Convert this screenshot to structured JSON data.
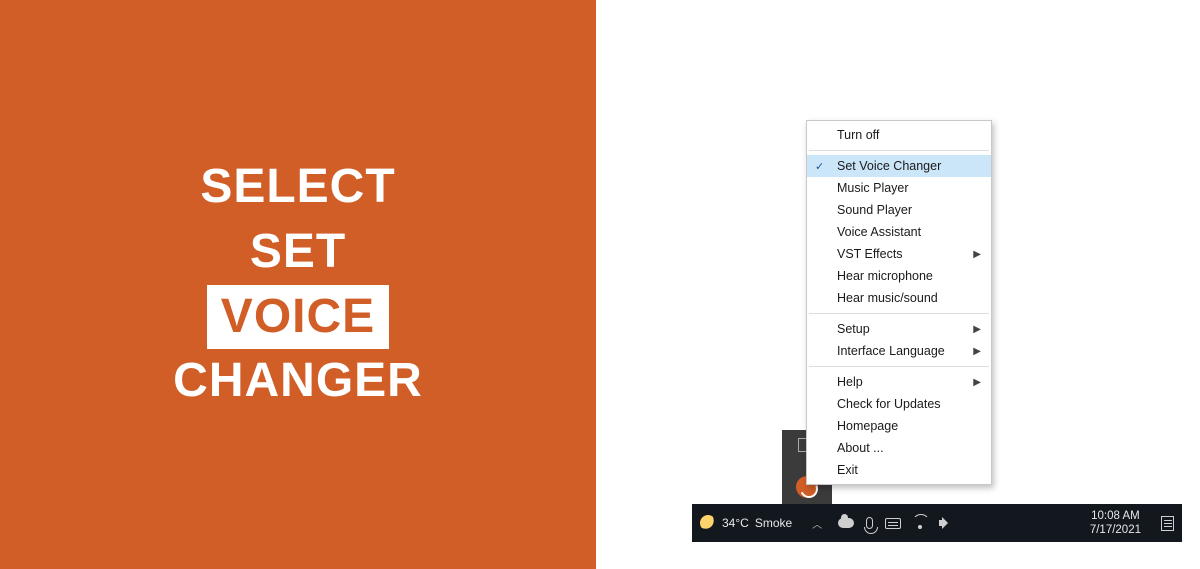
{
  "left_panel": {
    "line1": "SELECT",
    "line2": "SET",
    "line3_boxed": "VOICE",
    "line4": "CHANGER"
  },
  "context_menu": {
    "sections": [
      {
        "items": [
          {
            "label": "Turn off",
            "checked": false,
            "submenu": false
          }
        ]
      },
      {
        "items": [
          {
            "label": "Set Voice Changer",
            "checked": true,
            "submenu": false,
            "selected": true
          },
          {
            "label": "Music Player",
            "checked": false,
            "submenu": false
          },
          {
            "label": "Sound Player",
            "checked": false,
            "submenu": false
          },
          {
            "label": "Voice Assistant",
            "checked": false,
            "submenu": false
          },
          {
            "label": "VST Effects",
            "checked": false,
            "submenu": true
          },
          {
            "label": "Hear microphone",
            "checked": false,
            "submenu": false
          },
          {
            "label": "Hear music/sound",
            "checked": false,
            "submenu": false
          }
        ]
      },
      {
        "items": [
          {
            "label": "Setup",
            "checked": false,
            "submenu": true
          },
          {
            "label": "Interface Language",
            "checked": false,
            "submenu": true
          }
        ]
      },
      {
        "items": [
          {
            "label": "Help",
            "checked": false,
            "submenu": true
          },
          {
            "label": "Check for Updates",
            "checked": false,
            "submenu": false
          },
          {
            "label": "Homepage",
            "checked": false,
            "submenu": false
          },
          {
            "label": "About ...",
            "checked": false,
            "submenu": false
          },
          {
            "label": "Exit",
            "checked": false,
            "submenu": false
          }
        ]
      }
    ]
  },
  "taskbar": {
    "weather_temp": "34°C",
    "weather_desc": "Smoke",
    "time": "10:08 AM",
    "date": "7/17/2021"
  }
}
